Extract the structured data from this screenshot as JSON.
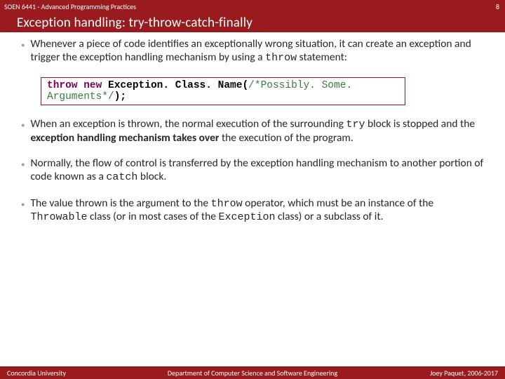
{
  "header": {
    "course": "SOEN 6441 - Advanced Programming Practices",
    "slide_number": "8"
  },
  "title": "Exception handling: try-throw-catch-finally",
  "bullets": [
    {
      "pre": "Whenever a piece of code identifies an exceptionally wrong situation, it can create an exception and trigger the exception handling mechanism by using a ",
      "code": "throw",
      "post": " statement:"
    },
    {
      "pre": "When an exception is thrown, the normal execution of the surrounding ",
      "code": "try",
      "mid": " block is stopped and the ",
      "bold": "exception handling mechanism takes over",
      "post2": " the execution of the program."
    },
    {
      "pre": "Normally, the flow of control is transferred by the exception handling mechanism to another portion of code known as a ",
      "code": "catch",
      "post": " block."
    },
    {
      "pre": "The value thrown is the argument to the ",
      "code": "throw",
      "mid": " operator, which must be an instance of the ",
      "code2": "Throwable",
      "mid2": " class (or in most cases of the ",
      "code3": "Exception",
      "post2": " class) or a subclass of it."
    }
  ],
  "code_sample": {
    "kw1": "throw",
    "kw2": "new",
    "classname": "Exception. Class. Name(",
    "comment": "/*Possibly. Some. Arguments*/",
    "close": ");"
  },
  "footer": {
    "left": "Concordia University",
    "center": "Department of Computer Science and Software Engineering",
    "right": "Joey Paquet, 2006-2017"
  }
}
